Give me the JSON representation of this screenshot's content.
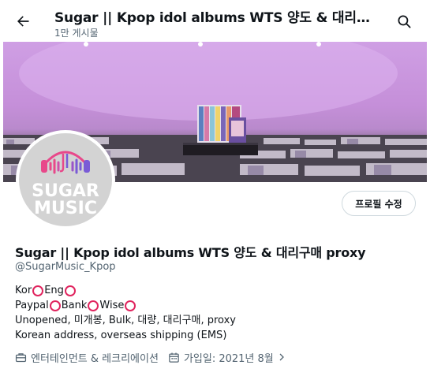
{
  "header": {
    "title": "Sugar || Kpop idol albums WTS 양도 & 대리구매 proxy",
    "post_count": "1만 게시물"
  },
  "profile": {
    "avatar_text_line1": "SUGAR",
    "avatar_text_line2": "MUSIC",
    "edit_button": "프로필 수정",
    "name": "Sugar || Kpop idol albums WTS 양도 & 대리구매 proxy",
    "handle": "@SugarMusic_Kpop"
  },
  "bio": {
    "line1_a": "Kor",
    "line1_b": "Eng",
    "line2_a": "Paypal",
    "line2_b": "Bank",
    "line2_c": "Wise",
    "line3": "Unopened, 미개봉, Bulk, 대량, 대리구매, proxy",
    "line4": "Korean address, overseas shipping (EMS)"
  },
  "meta": {
    "category": "엔터테인먼트 & 레크리에이션",
    "joined": "가입일: 2021년 8월"
  },
  "colors": {
    "accent_circle": "#e0245e",
    "secondary_text": "#536471",
    "avatar_pink": "#e8488a",
    "avatar_purple": "#7a5bd6"
  }
}
